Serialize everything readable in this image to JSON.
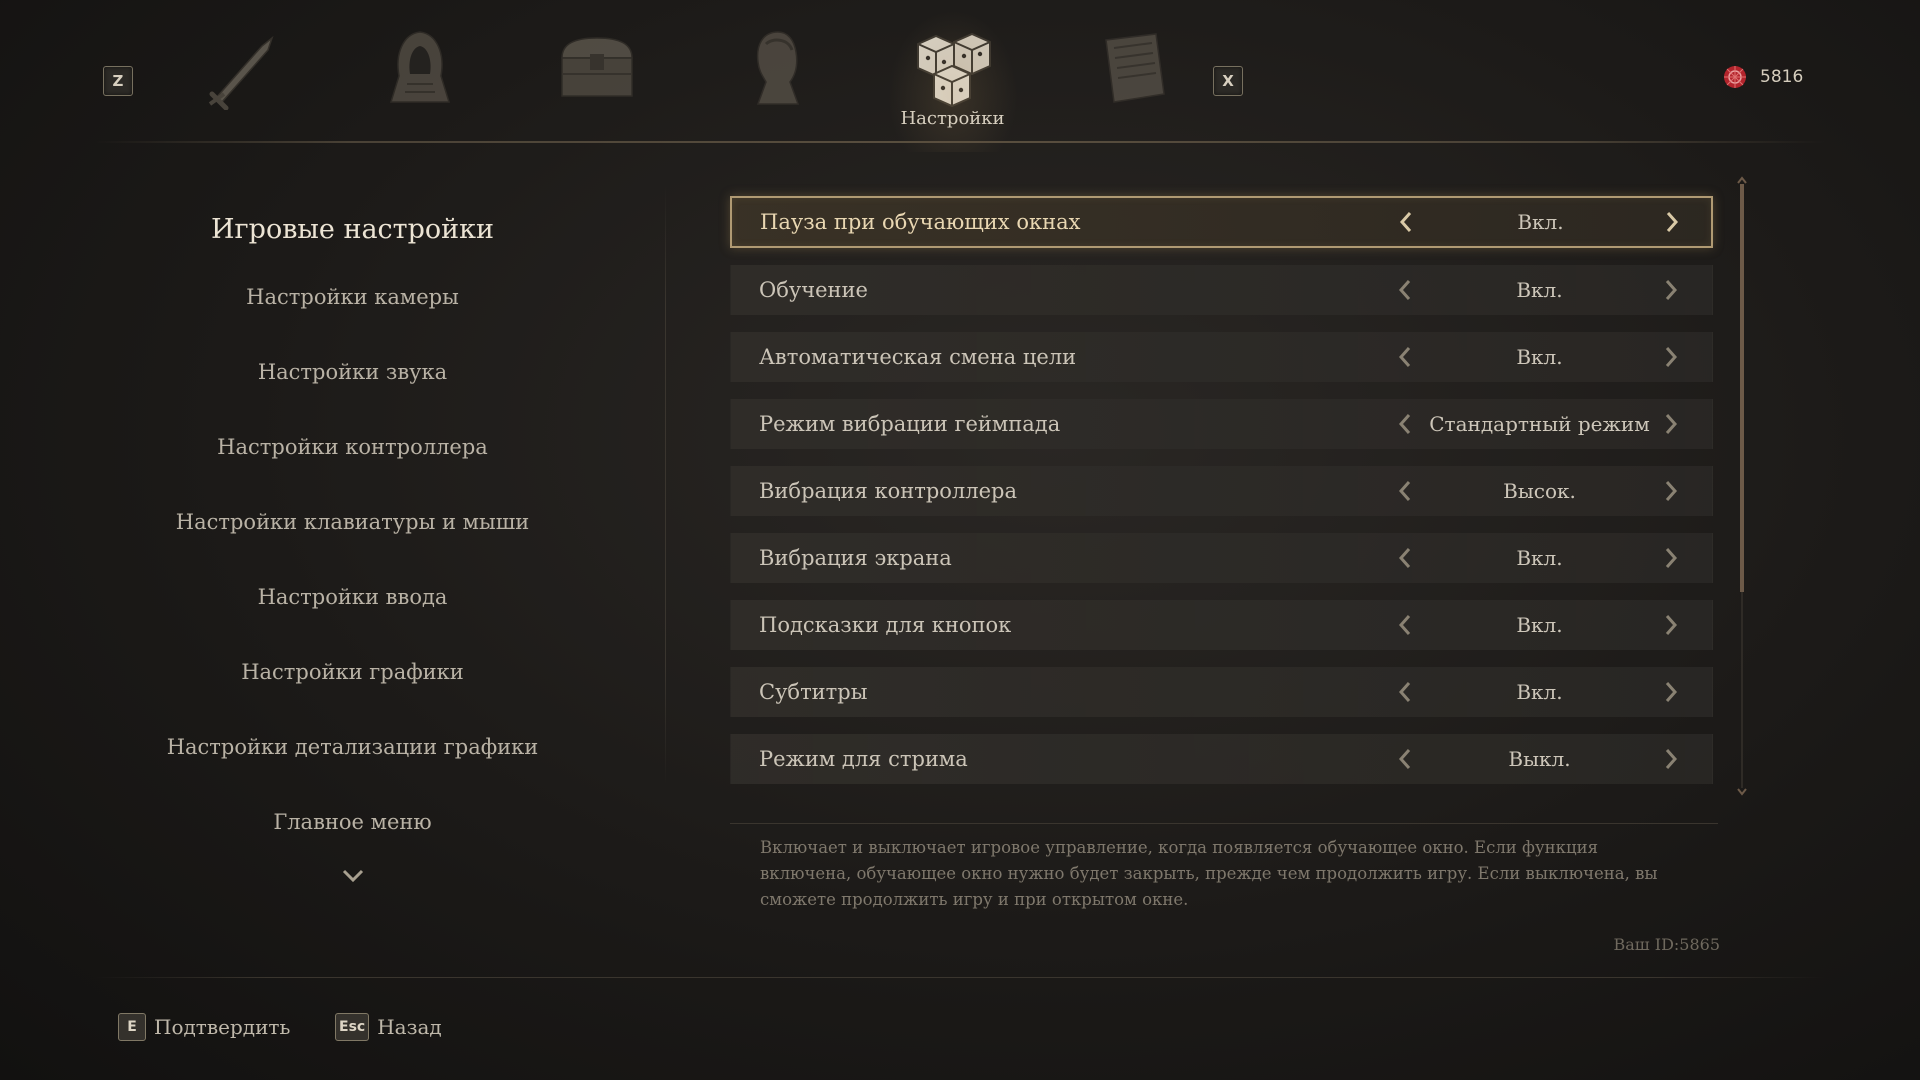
{
  "topbar": {
    "left_key": "Z",
    "right_key": "X",
    "tabs": [
      {
        "icon": "sword-icon"
      },
      {
        "icon": "hooded-armor-icon"
      },
      {
        "icon": "treasure-chest-icon"
      },
      {
        "icon": "character-portrait-icon"
      },
      {
        "icon": "dice-settings-icon",
        "label": "Настройки",
        "active": true
      },
      {
        "icon": "journal-book-icon"
      }
    ],
    "active_tab_label": "Настройки",
    "currency": {
      "icon": "soul-currency-icon",
      "amount": "5816"
    }
  },
  "sidebar": {
    "heading": "Игровые настройки",
    "items": [
      {
        "label": "Настройки камеры"
      },
      {
        "label": "Настройки звука"
      },
      {
        "label": "Настройки контроллера"
      },
      {
        "label": "Настройки клавиатуры и мыши"
      },
      {
        "label": "Настройки ввода"
      },
      {
        "label": "Настройки графики"
      },
      {
        "label": "Настройки детализации графики"
      },
      {
        "label": "Главное меню"
      }
    ]
  },
  "settings": {
    "rows": [
      {
        "label": "Пауза при обучающих окнах",
        "value": "Вкл.",
        "selected": true
      },
      {
        "label": "Обучение",
        "value": "Вкл."
      },
      {
        "label": "Автоматическая смена цели",
        "value": "Вкл."
      },
      {
        "label": "Режим вибрации геймпада",
        "value": "Стандартный режим"
      },
      {
        "label": "Вибрация контроллера",
        "value": "Высок."
      },
      {
        "label": "Вибрация экрана",
        "value": "Вкл."
      },
      {
        "label": "Подсказки для кнопок",
        "value": "Вкл."
      },
      {
        "label": "Субтитры",
        "value": "Вкл."
      },
      {
        "label": "Режим для стрима",
        "value": "Выкл."
      }
    ],
    "description": "Включает и выключает игровое управление, когда появляется обучающее окно. Если функция включена, обучающее окно нужно будет закрыть, прежде чем продолжить игру. Если выключена, вы сможете продолжить игру и при открытом окне.",
    "user_id": "Ваш ID:5865"
  },
  "footer": {
    "confirm": {
      "key": "E",
      "label": "Подтвердить"
    },
    "back": {
      "key": "Esc",
      "label": "Назад"
    }
  },
  "colors": {
    "accent": "#b09a73",
    "scroll_thumb": "#6d5a48",
    "currency": "#b3242c"
  }
}
